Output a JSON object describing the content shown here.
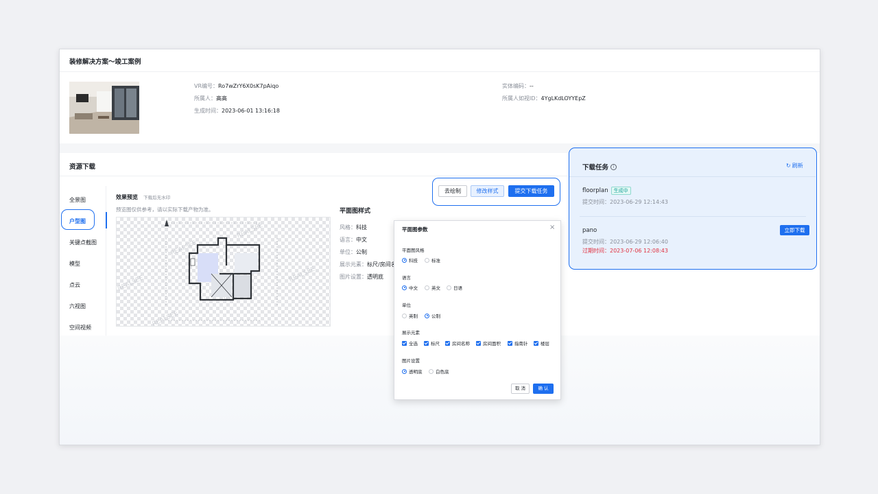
{
  "page": {
    "title": "装修解决方案～竣工案例"
  },
  "info": {
    "vr_label": "VR编号：",
    "vr_value": "Ro7wZrY6X0sK7pAiqo",
    "owner_label": "所属人：",
    "owner_value": "高高",
    "created_label": "生成时间：",
    "created_value": "2023-06-01 13:16:18",
    "entity_label": "实体编码：",
    "entity_value": "--",
    "owner_id_label": "所属人如视ID：",
    "owner_id_value": "4YgLKdLOYYEpZ"
  },
  "resources": {
    "title": "资源下载",
    "nav": [
      {
        "label": "全景图",
        "active": false
      },
      {
        "label": "户型图",
        "active": true
      },
      {
        "label": "关键点截图",
        "active": false
      },
      {
        "label": "模型",
        "active": false
      },
      {
        "label": "点云",
        "active": false
      },
      {
        "label": "六视图",
        "active": false
      },
      {
        "label": "空间视频",
        "active": false
      }
    ],
    "preview_title": "效果预览",
    "preview_sub": "下载后无水印",
    "preview_note": "预览图仅供参考，请以实际下载产物为准。",
    "buttons": {
      "draw": "去绘制",
      "modify": "修改样式",
      "submit": "提交下载任务"
    }
  },
  "floorplan_style": {
    "title": "平面图样式",
    "rows": [
      {
        "k": "风格：",
        "v": "科技"
      },
      {
        "k": "语言：",
        "v": "中文"
      },
      {
        "k": "单位：",
        "v": "公制"
      },
      {
        "k": "展示元素：",
        "v": "标尺/房间名"
      },
      {
        "k": "图片设置：",
        "v": "透明底"
      }
    ]
  },
  "floorplan_image": {
    "watermark": "REALSEE"
  },
  "modal": {
    "title": "平面图参数",
    "style_label": "平面图风格",
    "style_options": [
      {
        "label": "科技",
        "checked": true
      },
      {
        "label": "标准",
        "checked": false
      }
    ],
    "lang_label": "语言",
    "lang_options": [
      {
        "label": "中文",
        "checked": true
      },
      {
        "label": "英文",
        "checked": false
      },
      {
        "label": "日语",
        "checked": false
      }
    ],
    "unit_label": "单位",
    "unit_options": [
      {
        "label": "英制",
        "checked": false
      },
      {
        "label": "公制",
        "checked": true
      }
    ],
    "elements_label": "展示元素",
    "elements": [
      {
        "label": "全选",
        "checked": true
      },
      {
        "label": "标尺",
        "checked": true
      },
      {
        "label": "房间名称",
        "checked": true
      },
      {
        "label": "房间面积",
        "checked": true
      },
      {
        "label": "指南针",
        "checked": true
      },
      {
        "label": "楼层",
        "checked": true
      }
    ],
    "img_label": "图片设置",
    "img_options": [
      {
        "label": "透明底",
        "checked": true
      },
      {
        "label": "白色底",
        "checked": false
      }
    ],
    "cancel": "取 消",
    "confirm": "确 认"
  },
  "tasks": {
    "title": "下载任务",
    "refresh": "刷新",
    "items": [
      {
        "name": "floorplan",
        "status": "生成中",
        "submit_label": "提交时间：",
        "submit_time": "2023-06-29 12:14:43"
      },
      {
        "name": "pano",
        "action": "立即下载",
        "submit_label": "提交时间：",
        "submit_time": "2023-06-29 12:06:40",
        "expire_label": "过期时间：",
        "expire_time": "2023-07-06 12:08:43"
      }
    ]
  },
  "colors": {
    "accent": "#1e6fef",
    "danger": "#e0313f",
    "tag": "#1aa39a"
  }
}
